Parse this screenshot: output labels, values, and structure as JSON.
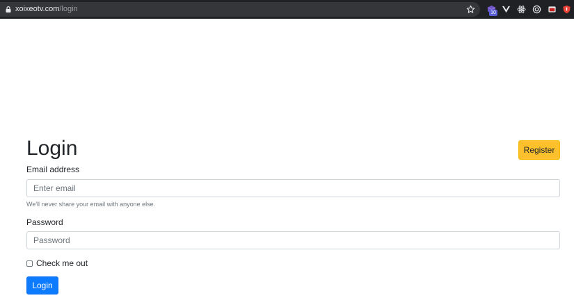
{
  "browser": {
    "url_host": "xoixeotv.com",
    "url_path": "/login",
    "extension_badge": "10",
    "extension_icons": [
      "cube-extension-icon",
      "vue-devtools-icon",
      "react-devtools-icon",
      "target-extension-icon",
      "window-extension-icon",
      "shield-extension-icon"
    ]
  },
  "page": {
    "title": "Login",
    "register_label": "Register"
  },
  "form": {
    "email_label": "Email address",
    "email_placeholder": "Enter email",
    "email_value": "",
    "email_help": "We'll never share your email with anyone else.",
    "password_label": "Password",
    "password_placeholder": "Password",
    "password_value": "",
    "remember_label": "Check me out",
    "remember_checked": false,
    "submit_label": "Login"
  },
  "colors": {
    "chrome_bg": "#202124",
    "register_button": "#fcc02c",
    "login_button": "#0d7bff",
    "text": "#212529",
    "muted": "#6c757d"
  }
}
